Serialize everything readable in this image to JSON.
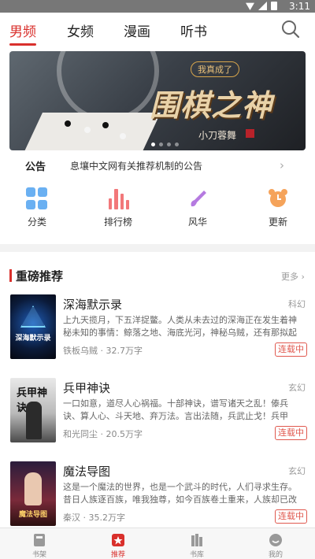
{
  "status_bar": {
    "time": "3:11"
  },
  "top_tabs": [
    {
      "label": "男频",
      "active": true
    },
    {
      "label": "女频",
      "active": false
    },
    {
      "label": "漫画",
      "active": false
    },
    {
      "label": "听书",
      "active": false
    }
  ],
  "banner": {
    "subtitle": "我真成了",
    "title": "围棋之神",
    "author": "小刀蓉舞"
  },
  "notice": {
    "label": "公告",
    "text": "息壤中文网有关推荐机制的公告"
  },
  "quick_links": [
    {
      "label": "分类",
      "icon": "category-grid-icon",
      "color": "#6ab0f2"
    },
    {
      "label": "排行榜",
      "icon": "ranking-bars-icon",
      "color": "#f2787a"
    },
    {
      "label": "风华",
      "icon": "brush-icon",
      "color": "#b57ae0"
    },
    {
      "label": "更新",
      "icon": "alarm-clock-icon",
      "color": "#f5a35a"
    }
  ],
  "recommend": {
    "title": "重磅推荐",
    "more": "更多",
    "books": [
      {
        "name": "深海默示录",
        "genre": "科幻",
        "desc": "上九天揽月，下五洋捉鳖。人类从未去过的深海正在发生着神秘未知的事情：鲸落之地、海底光河，神秘乌贼，还有那拟起泪…",
        "author": "铁板乌贼",
        "words": "32.7万字",
        "tag": "连载中",
        "cover_text": "深海默示录"
      },
      {
        "name": "兵甲神诀",
        "genre": "玄幻",
        "desc": "一口如意，道尽人心祸福。十部神诀，谱写诸天之乱！傣兵诀、算人心、斗天地、弃万法。言出法随，兵武止戈！兵甲诀，这十…",
        "author": "和光同尘",
        "words": "20.5万字",
        "tag": "连载中",
        "cover_text": "兵甲神诀"
      },
      {
        "name": "魔法导图",
        "genre": "玄幻",
        "desc": "这是一个魔法的世界，也是一个武斗的时代，人们寻求生存。昔日人族逐百族，唯我独尊，如今百族卷土重来，人族却已改纪…",
        "author": "秦汉",
        "words": "35.2万字",
        "tag": "连载中",
        "cover_text": "魔法导图"
      }
    ]
  },
  "bottom_nav": [
    {
      "label": "书架",
      "active": false
    },
    {
      "label": "推荐",
      "active": true
    },
    {
      "label": "书库",
      "active": false
    },
    {
      "label": "我的",
      "active": false
    }
  ],
  "colors": {
    "accent": "#d9302c",
    "tag": "#e0584e"
  }
}
